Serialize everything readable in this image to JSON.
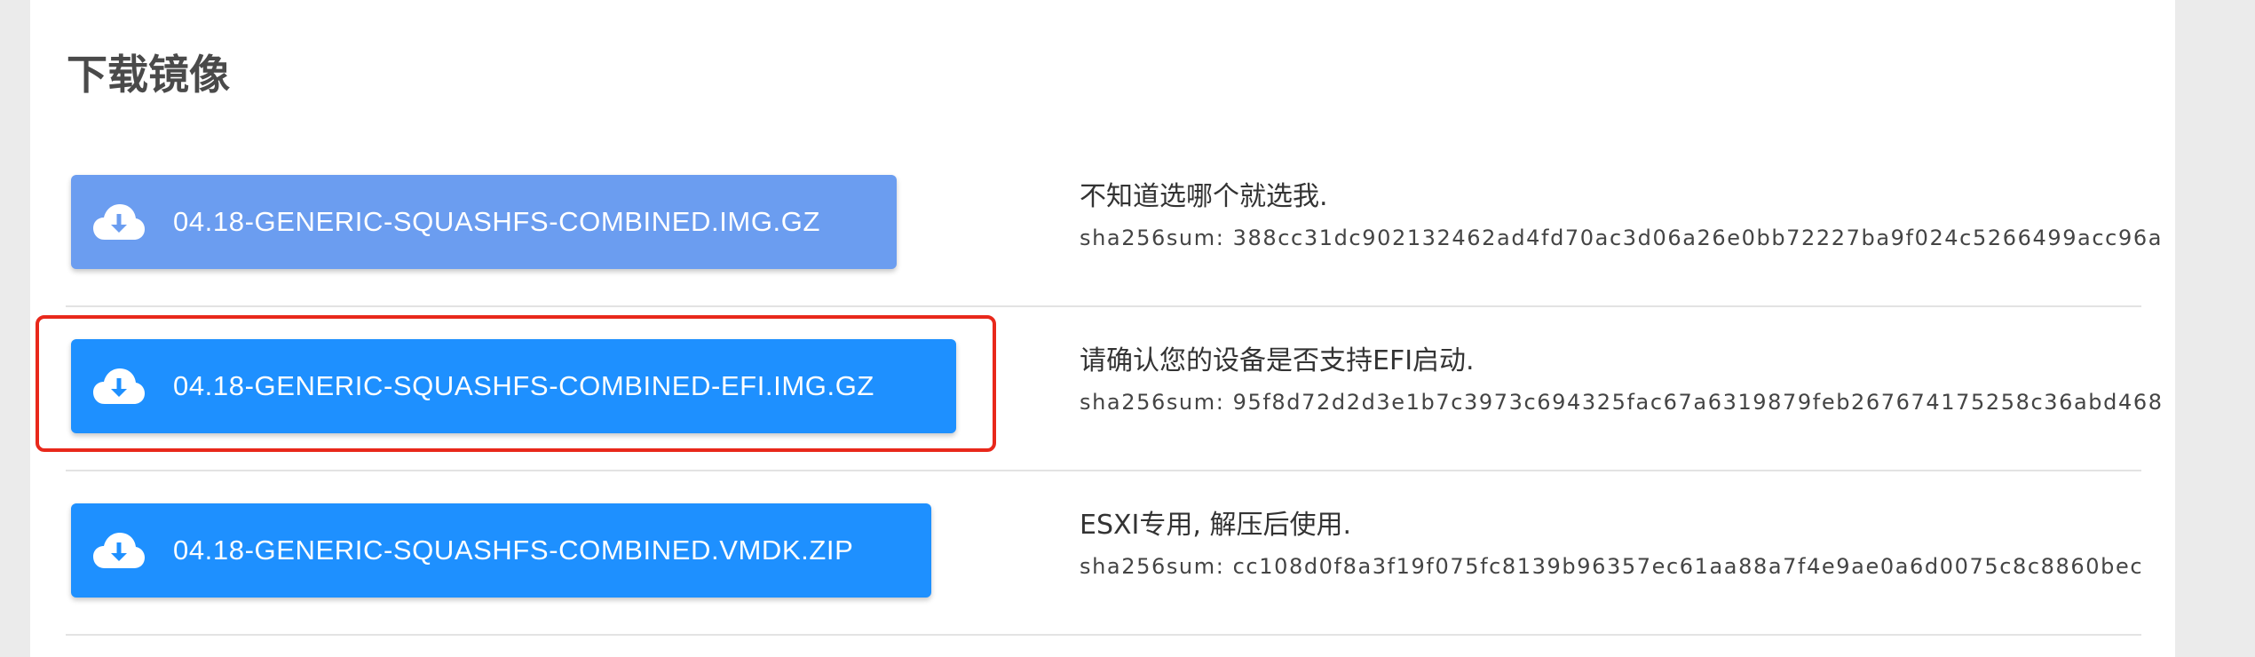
{
  "section": {
    "title": "下载镜像"
  },
  "downloads": [
    {
      "label": "04.18-GENERIC-SQUASHFS-COMBINED.IMG.GZ",
      "description": "不知道选哪个就选我.",
      "sha256": "sha256sum: 388cc31dc902132462ad4fd70ac3d06a26e0bb72227ba9f024c5266499acc96a",
      "icon": "cloud-download-icon",
      "color": "#6b9df0"
    },
    {
      "label": "04.18-GENERIC-SQUASHFS-COMBINED-EFI.IMG.GZ",
      "description": "请确认您的设备是否支持EFI启动.",
      "sha256": "sha256sum: 95f8d72d2d3e1b7c3973c694325fac67a6319879feb267674175258c36abd468",
      "icon": "cloud-download-icon",
      "color": "#1e90ff",
      "highlighted": true
    },
    {
      "label": "04.18-GENERIC-SQUASHFS-COMBINED.VMDK.ZIP",
      "description": "ESXI专用, 解压后使用.",
      "sha256": "sha256sum: cc108d0f8a3f19f075fc8139b96357ec61aa88a7f4e9ae0a6d0075c8c8860bec",
      "icon": "cloud-download-icon",
      "color": "#1e90ff"
    }
  ],
  "colors": {
    "highlight_border": "#e8281b",
    "page_background": "#ebebeb",
    "card_background": "#ffffff"
  }
}
